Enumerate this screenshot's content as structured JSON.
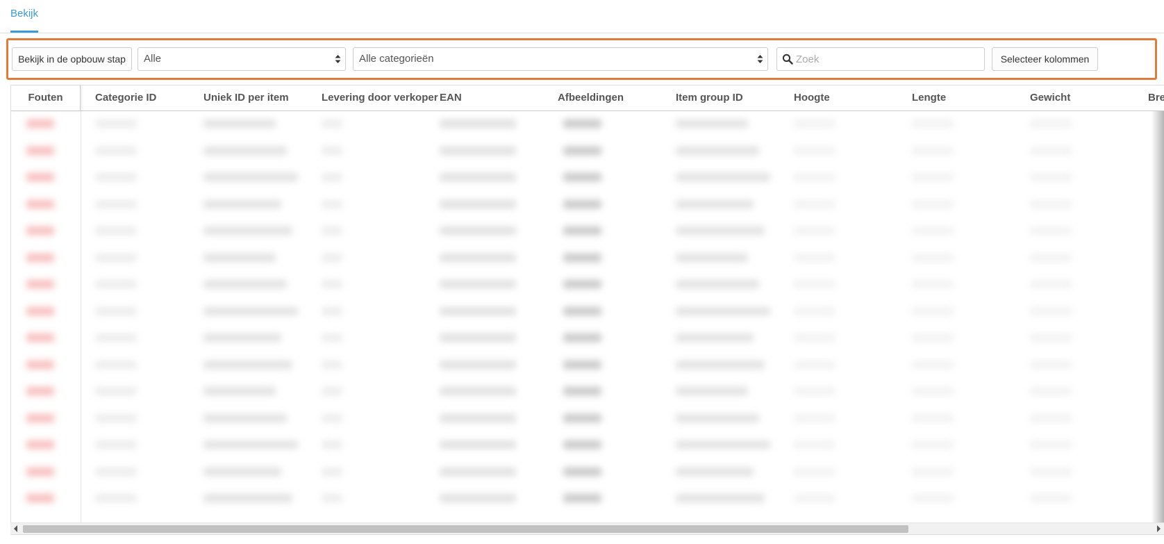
{
  "tabs": [
    {
      "label": "Bekijk",
      "active": true
    }
  ],
  "toolbar": {
    "view_button_label": "Bekijk in de opbouw stap",
    "status_select_value": "Alle",
    "category_select_value": "Alle categorieën",
    "search_placeholder": "Zoek",
    "columns_button_label": "Selecteer kolommen"
  },
  "colors": {
    "accent": "#3a9bd5",
    "highlight_border": "#e07b39",
    "error_text": "#f5a6a6"
  },
  "table": {
    "columns": [
      "Fouten",
      "Categorie ID",
      "Uniek ID per item",
      "Levering door verkoper",
      "EAN",
      "Afbeeldingen",
      "Item group ID",
      "Hoogte",
      "Lengte",
      "Gewicht",
      "Bre"
    ]
  }
}
